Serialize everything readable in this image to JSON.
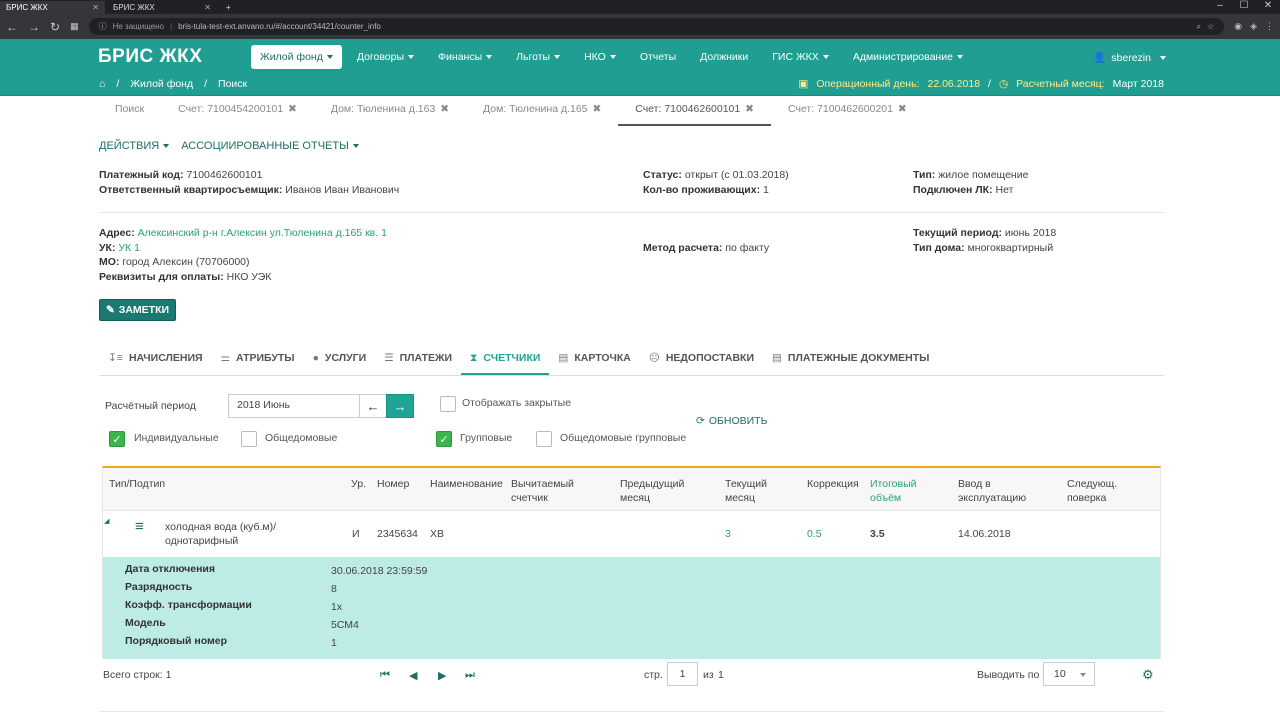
{
  "browser": {
    "tabs": [
      {
        "label": "БРИС ЖКХ",
        "active": true
      },
      {
        "label": "БРИС ЖКХ",
        "active": false
      }
    ],
    "not_secure": "Не защищено",
    "url": "bris-tula-test-ext.anvano.ru/#/account/34421/counter_info"
  },
  "app": {
    "brand": "БРИС ЖКХ",
    "accent": "#1f9e91"
  },
  "nav": {
    "items": [
      "Жилой фонд",
      "Договоры",
      "Финансы",
      "Льготы",
      "НКО",
      "Отчеты",
      "Должники",
      "ГИС ЖКХ",
      "Администрирование"
    ],
    "user": "sberezin"
  },
  "breadcrumb": {
    "items": [
      "Жилой фонд",
      "Поиск"
    ],
    "sep": "/"
  },
  "opday": {
    "day_label": "Операционный день:",
    "day_value": "22.06.2018",
    "sep": "/",
    "month_label": "Расчетный месяц:",
    "month_value": "Март 2018"
  },
  "subtabs": [
    "Поиск",
    "Счет: 7100454200101",
    "Дом: Тюленина д.163",
    "Дом: Тюленина д.165",
    "Счет: 7100462600101",
    "Счет: 7100462600201"
  ],
  "actions": {
    "actions": "ДЕЙСТВИЯ",
    "reports": "АССОЦИИРОВАННЫЕ ОТЧЕТЫ"
  },
  "account": {
    "pay_code_label": "Платежный код:",
    "pay_code": "7100462600101",
    "resp_label": "Ответственный квартиросъемщик:",
    "resp": "Иванов Иван Иванович",
    "status_label": "Статус:",
    "status": "открыт (с 01.03.2018)",
    "residents_label": "Кол-во проживающих:",
    "residents": "1",
    "type_label": "Тип:",
    "type": "жилое помещение",
    "lk_label": "Подключен ЛК:",
    "lk": "Нет",
    "address_label": "Адрес:",
    "address": "Алексинский р-н г.Алексин ул.Тюленина д.165 кв. 1",
    "uk_label": "УК:",
    "uk": "УК 1",
    "mo_label": "МО:",
    "mo": "город Алексин (70706000)",
    "req_label": "Реквизиты для оплаты:",
    "req": "НКО УЭК",
    "method_label": "Метод расчета:",
    "method": "по факту",
    "period_label": "Текущий период:",
    "period": "июнь 2018",
    "house_label": "Тип дома:",
    "house": "многоквартирный"
  },
  "notes_button": "ЗАМЕТКИ",
  "tabs": [
    {
      "label": "НАЧИСЛЕНИЯ",
      "icon": "sort-icon"
    },
    {
      "label": "АТРИБУТЫ",
      "icon": "sliders-icon"
    },
    {
      "label": "УСЛУГИ",
      "icon": "drop-icon"
    },
    {
      "label": "ПЛАТЕЖИ",
      "icon": "database-icon"
    },
    {
      "label": "СЧЕТЧИКИ",
      "icon": "hourglass-icon"
    },
    {
      "label": "КАРТОЧКА",
      "icon": "card-icon"
    },
    {
      "label": "НЕДОПОСТАВКИ",
      "icon": "frown-icon"
    },
    {
      "label": "ПЛАТЕЖНЫЕ ДОКУМЕНТЫ",
      "icon": "list-icon"
    }
  ],
  "filters": {
    "period_label": "Расчётный период",
    "period_value": "2018 Июнь",
    "show_closed": "Отображать закрытые",
    "individual": "Индивидуальные",
    "common": "Общедомовые",
    "group": "Групповые",
    "common_group": "Общедомовые групповые",
    "refresh": "ОБНОВИТЬ"
  },
  "grid": {
    "headers": {
      "type": "Тип/Подтип",
      "level": "Ур.",
      "number": "Номер",
      "name": "Наименование",
      "subtract_1": "Вычитаемый",
      "subtract_2": "счетчик",
      "prev_1": "Предыдущий",
      "prev_2": "месяц",
      "cur_1": "Текущий",
      "cur_2": "месяц",
      "corr": "Коррекция",
      "total_1": "Итоговый",
      "total_2": "объём",
      "commission_1": "Ввод в",
      "commission_2": "эксплуатацию",
      "next_1": "Следующ.",
      "next_2": "поверка"
    },
    "row": {
      "type_1": "холодная вода (куб.м)/",
      "type_2": "однотарифный",
      "level": "И",
      "number": "2345634",
      "name": "ХВ",
      "current": "3",
      "correction": "0.5",
      "total": "3.5",
      "commission": "14.06.2018"
    },
    "detail": [
      {
        "label": "Дата отключения",
        "value": "30.06.2018 23:59:59"
      },
      {
        "label": "Разрядность",
        "value": "8"
      },
      {
        "label": "Коэфф. трансформации",
        "value": "1х"
      },
      {
        "label": "Модель",
        "value": "5СМ4"
      },
      {
        "label": "Порядковый номер",
        "value": "1"
      }
    ]
  },
  "footer": {
    "total": "Всего строк: 1",
    "page_label": "стр.",
    "page": "1",
    "of_label": "из",
    "of": "1",
    "per_page_label": "Выводить по",
    "per_page": "10"
  }
}
